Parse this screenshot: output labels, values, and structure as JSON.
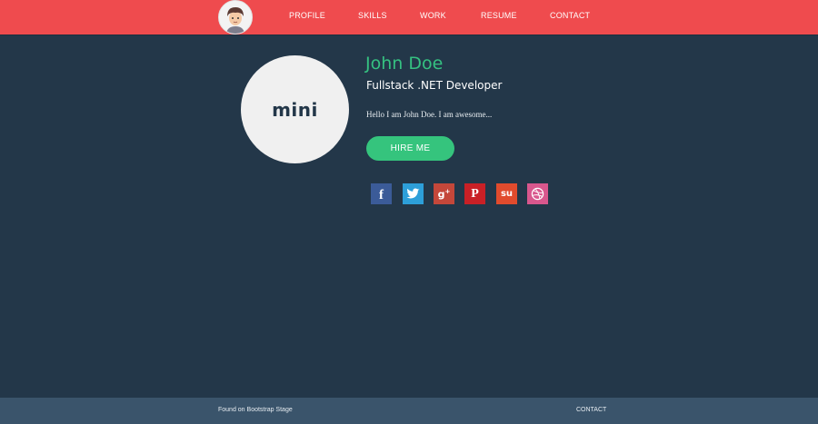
{
  "nav": {
    "links": [
      "PROFILE",
      "SKILLS",
      "WORK",
      "RESUME",
      "CONTACT"
    ],
    "background_color": "#ef4b4e"
  },
  "profile": {
    "avatar_text": "mini",
    "name": "John Doe",
    "role": "Fullstack .NET Developer",
    "bio": "Hello I am John Doe. I am awesome...",
    "hire_label": "HIRE ME",
    "accent_color": "#35c181"
  },
  "social": [
    {
      "icon": "facebook-icon",
      "glyph": "f",
      "color": "#3b5b98"
    },
    {
      "icon": "twitter-icon",
      "glyph": "",
      "color": "#2d9fd9"
    },
    {
      "icon": "google-plus-icon",
      "glyph": "g+",
      "color": "#c4473a"
    },
    {
      "icon": "pinterest-icon",
      "glyph": "P",
      "color": "#c92026"
    },
    {
      "icon": "stumbleupon-icon",
      "glyph": "su",
      "color": "#e14b2d"
    },
    {
      "icon": "dribbble-icon",
      "glyph": "",
      "color": "#d9578d"
    }
  ],
  "footer": {
    "left_text": "Found on Bootstrap Stage",
    "right_link": "CONTACT"
  }
}
